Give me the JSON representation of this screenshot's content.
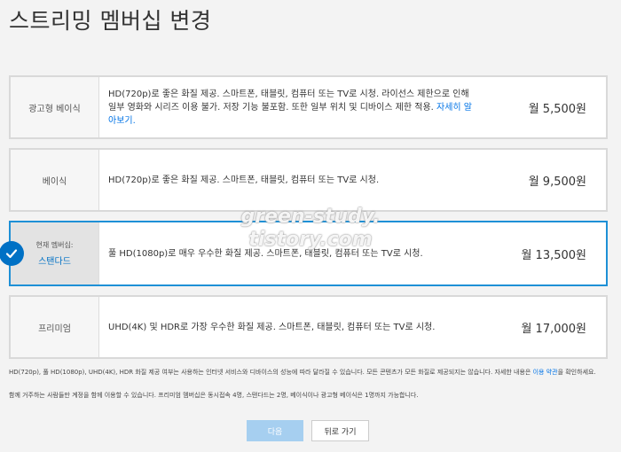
{
  "page": {
    "title": "스트리밍 멤버십 변경"
  },
  "plans": [
    {
      "name": "광고형 베이식",
      "desc": "HD(720p)로 좋은 화질 제공. 스마트폰, 태블릿, 컴퓨터 또는 TV로 시청. 라이선스 제한으로 인해 일부 영화와 시리즈 이용 불가. 저장 기능 불포함. 또한 일부 위치 및 디바이스 제한 적용.",
      "link": "자세히 알아보기.",
      "price": "월 5,500원"
    },
    {
      "name": "베이식",
      "desc": "HD(720p)로 좋은 화질 제공. 스마트폰, 태블릿, 컴퓨터 또는 TV로 시청.",
      "price": "월 9,500원"
    },
    {
      "current_label": "현재 멤버십:",
      "name": "스탠다드",
      "desc": "풀 HD(1080p)로 매우 우수한 화질 제공. 스마트폰, 태블릿, 컴퓨터 또는 TV로 시청.",
      "price": "월 13,500원",
      "selected": true
    },
    {
      "name": "프리미엄",
      "desc": "UHD(4K) 및 HDR로 가장 우수한 화질 제공. 스마트폰, 태블릿, 컴퓨터 또는 TV로 시청.",
      "price": "월 17,000원"
    }
  ],
  "footer": {
    "note1": "HD(720p), 풀 HD(1080p), UHD(4K), HDR 화질 제공 여부는 사용하는 인터넷 서비스와 디바이스의 성능에 따라 달라질 수 있습니다. 모든 콘텐츠가 모든 화질로 제공되지는 않습니다. 자세한 내용은",
    "terms_link": "이용 약관",
    "note1_end": "을 확인하세요.",
    "note2": "함께 거주하는 사람들만 계정을 함께 이용할 수 있습니다. 프리미엄 멤버십은 동시접속 4명, 스탠다드는 2명, 베이식이나 광고형 베이식은 1명까지 가능합니다."
  },
  "buttons": {
    "next": "다음",
    "back": "뒤로 가기"
  },
  "watermark": {
    "line1": "green-study.",
    "line2": "tistory.com"
  },
  "colors": {
    "accent": "#0071c5",
    "selected_border": "#1e90d6",
    "next_button": "#a6cff0"
  },
  "icons": {
    "selected": "check-circle-icon"
  }
}
